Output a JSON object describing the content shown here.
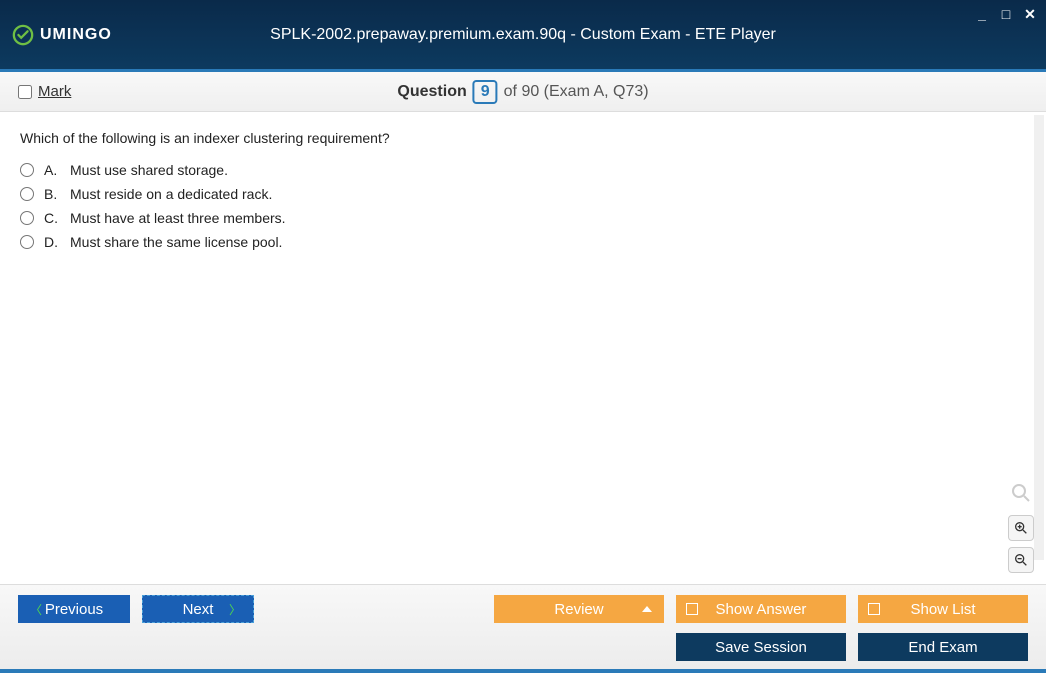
{
  "titlebar": {
    "logo_text": "UMINGO",
    "title": "SPLK-2002.prepaway.premium.exam.90q - Custom Exam - ETE Player"
  },
  "question_bar": {
    "mark_label": "Mark",
    "question_word": "Question",
    "current_number": "9",
    "of_text": "of 90 (Exam A, Q73)"
  },
  "content": {
    "question_text": "Which of the following is an indexer clustering requirement?",
    "options": [
      {
        "letter": "A.",
        "text": "Must use shared storage."
      },
      {
        "letter": "B.",
        "text": "Must reside on a dedicated rack."
      },
      {
        "letter": "C.",
        "text": "Must have at least three members."
      },
      {
        "letter": "D.",
        "text": "Must share the same license pool."
      }
    ]
  },
  "footer": {
    "previous": "Previous",
    "next": "Next",
    "review": "Review",
    "show_answer": "Show Answer",
    "show_list": "Show List",
    "save_session": "Save Session",
    "end_exam": "End Exam"
  }
}
